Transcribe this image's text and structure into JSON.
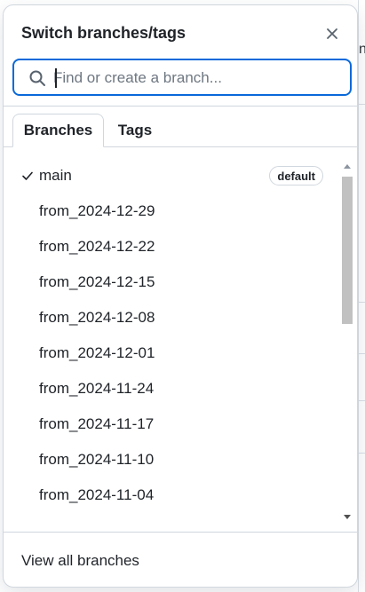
{
  "dialog": {
    "title": "Switch branches/tags",
    "close_icon": "close-icon"
  },
  "search": {
    "placeholder": "Find or create a branch...",
    "value": "",
    "icon": "search-icon"
  },
  "tabs": [
    {
      "label": "Branches",
      "active": true
    },
    {
      "label": "Tags",
      "active": false
    }
  ],
  "branches": [
    {
      "name": "main",
      "selected": true,
      "badge": "default"
    },
    {
      "name": "from_2024-12-29"
    },
    {
      "name": "from_2024-12-22"
    },
    {
      "name": "from_2024-12-15"
    },
    {
      "name": "from_2024-12-08"
    },
    {
      "name": "from_2024-12-01"
    },
    {
      "name": "from_2024-11-24"
    },
    {
      "name": "from_2024-11-17"
    },
    {
      "name": "from_2024-11-10"
    },
    {
      "name": "from_2024-11-04"
    }
  ],
  "footer": {
    "view_all_label": "View all branches"
  },
  "background": {
    "edge_letter": "n"
  },
  "colors": {
    "accent": "#0969da",
    "border": "#d0d7de",
    "text": "#1f2328"
  }
}
